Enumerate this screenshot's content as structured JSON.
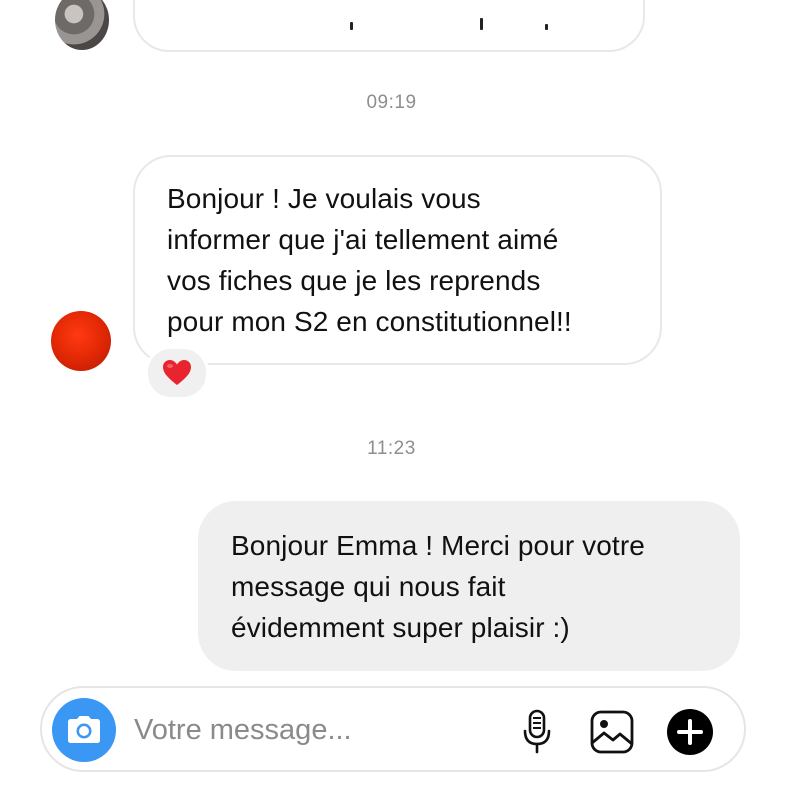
{
  "thread": {
    "timestamps": [
      "09:19",
      "11:23"
    ],
    "received_message": {
      "lines": [
        "Bonjour ! Je voulais vous",
        "informer que j'ai tellement aimé",
        "vos fiches que je les reprends",
        "pour mon S2 en constitutionnel!!"
      ],
      "reaction": "heart-icon"
    },
    "sent_message": {
      "lines": [
        "Bonjour Emma ! Merci pour votre",
        "message qui nous fait",
        "évidemment super plaisir :)"
      ]
    }
  },
  "composer": {
    "placeholder": "Votre message...",
    "icons": [
      "camera-icon",
      "microphone-icon",
      "gallery-icon",
      "plus-icon"
    ]
  },
  "colors": {
    "accent": "#3a97f3",
    "received_border": "#e8e8e8",
    "sent_bg": "#efefef",
    "timestamp": "#8e8e8e",
    "avatar_red": "#e52a06",
    "heart": "#e8242f"
  }
}
